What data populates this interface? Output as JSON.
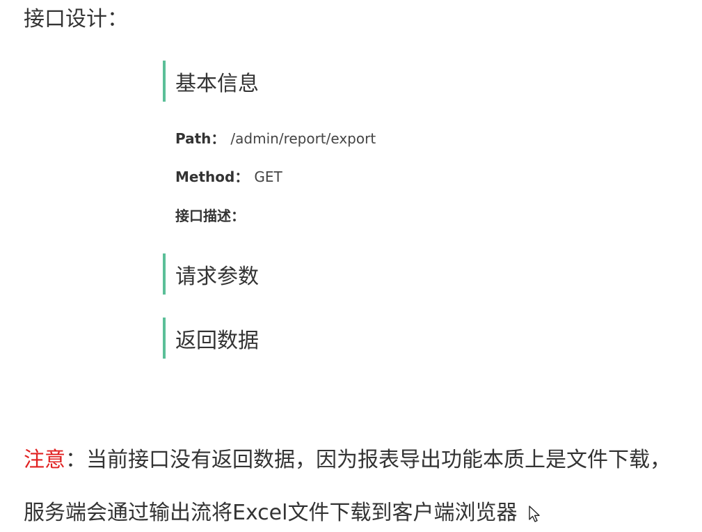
{
  "heading": "接口设计：",
  "sections": {
    "basic_info": "基本信息",
    "request_params": "请求参数",
    "response_data": "返回数据"
  },
  "info": {
    "path_label": "Path：",
    "path_value": "/admin/report/export",
    "method_label": "Method：",
    "method_value": "GET",
    "description_label": "接口描述："
  },
  "note": {
    "label": "注意",
    "line1_rest": "：当前接口没有返回数据，因为报表导出功能本质上是文件下载，",
    "line2": "服务端会通过输出流将Excel文件下载到客户端浏览器"
  },
  "colors": {
    "section_bar": "#5bbf98",
    "note_label": "#e02020",
    "text": "#333333"
  },
  "icons": {
    "cursor": "mouse-pointer-icon"
  }
}
